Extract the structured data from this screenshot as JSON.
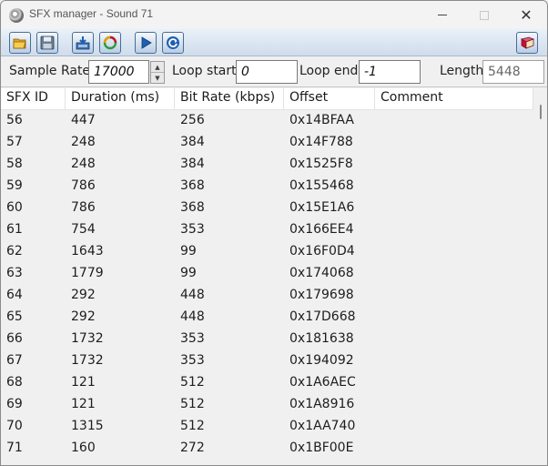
{
  "window": {
    "title": "SFX manager - Sound 71"
  },
  "toolbar": {
    "buttons": [
      {
        "name": "open-button",
        "icon": "folder-open-icon"
      },
      {
        "name": "save-button",
        "icon": "floppy-disk-icon"
      },
      {
        "name": "import-button",
        "icon": "import-icon"
      },
      {
        "name": "replace-button",
        "icon": "recycle-icon"
      },
      {
        "name": "play-button",
        "icon": "play-icon"
      },
      {
        "name": "loop-button",
        "icon": "loop-icon"
      },
      {
        "name": "help-button",
        "icon": "book-icon"
      }
    ]
  },
  "params": {
    "sample_rate_label": "Sample Rate",
    "sample_rate_value": "17000",
    "loop_start_label": "Loop start",
    "loop_start_value": "0",
    "loop_end_label": "Loop end",
    "loop_end_value": "-1",
    "length_label": "Length",
    "length_value": "5448"
  },
  "table": {
    "columns": [
      "SFX ID",
      "Duration (ms)",
      "Bit Rate (kbps)",
      "Offset",
      "Comment"
    ],
    "rows": [
      [
        "56",
        "447",
        "256",
        "0x14BFAA",
        ""
      ],
      [
        "57",
        "248",
        "384",
        "0x14F788",
        ""
      ],
      [
        "58",
        "248",
        "384",
        "0x1525F8",
        ""
      ],
      [
        "59",
        "786",
        "368",
        "0x155468",
        ""
      ],
      [
        "60",
        "786",
        "368",
        "0x15E1A6",
        ""
      ],
      [
        "61",
        "754",
        "353",
        "0x166EE4",
        ""
      ],
      [
        "62",
        "1643",
        "99",
        "0x16F0D4",
        ""
      ],
      [
        "63",
        "1779",
        "99",
        "0x174068",
        ""
      ],
      [
        "64",
        "292",
        "448",
        "0x179698",
        ""
      ],
      [
        "65",
        "292",
        "448",
        "0x17D668",
        ""
      ],
      [
        "66",
        "1732",
        "353",
        "0x181638",
        ""
      ],
      [
        "67",
        "1732",
        "353",
        "0x194092",
        ""
      ],
      [
        "68",
        "121",
        "512",
        "0x1A6AEC",
        ""
      ],
      [
        "69",
        "121",
        "512",
        "0x1A8916",
        ""
      ],
      [
        "70",
        "1315",
        "512",
        "0x1AA740",
        ""
      ],
      [
        "71",
        "160",
        "272",
        "0x1BF00E",
        ""
      ]
    ]
  },
  "colors": {
    "toolbar_button_border": "#4a6d96",
    "icon_blue": "#1f5fb3",
    "icon_red": "#c8102e"
  }
}
